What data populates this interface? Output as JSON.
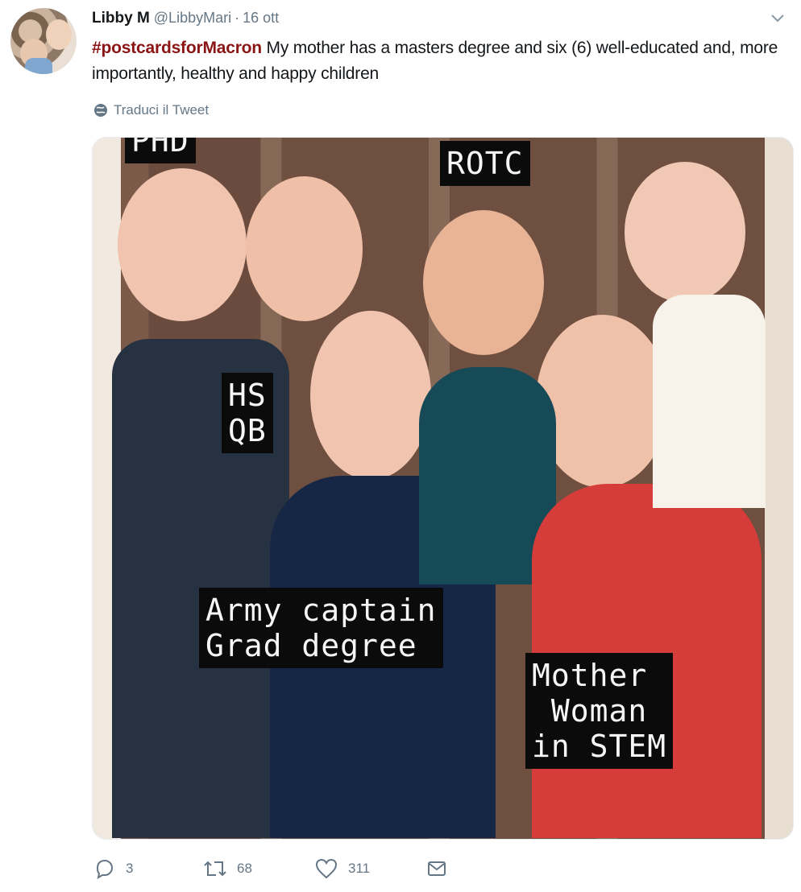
{
  "tweet": {
    "display_name": "Libby M",
    "handle": "@LibbyMari",
    "separator": "·",
    "date": "16 ott",
    "hashtag": "#postcardsforMacron",
    "text": " My mother has a masters degree and six (6) well-educated and, more importantly, healthy and happy children",
    "translate_label": "Traduci il Tweet"
  },
  "media": {
    "captions": {
      "top_left": "PHD",
      "rotc": "ROTC",
      "hs_qb": "HS\nQB",
      "army": "Army captain\nGrad degree",
      "mother": "Mother\n Woman\nin STEM"
    }
  },
  "actions": {
    "reply_count": "3",
    "retweet_count": "68",
    "like_count": "311"
  },
  "colors": {
    "hashtag": "#8b1515",
    "muted": "#657786"
  },
  "icons": [
    "globe-icon",
    "chevron-down-icon",
    "reply-icon",
    "retweet-icon",
    "heart-icon",
    "message-icon"
  ]
}
